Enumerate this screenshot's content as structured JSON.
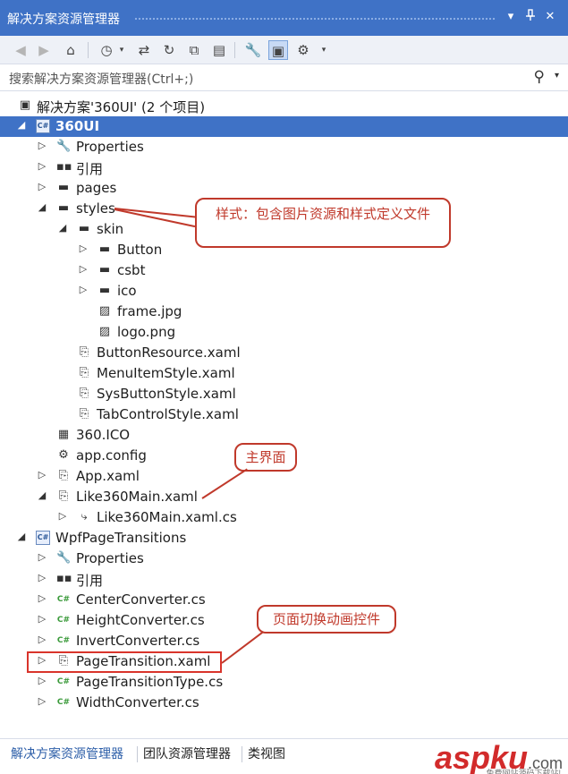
{
  "window": {
    "title": "解决方案资源管理器",
    "pin_symbol": "ᵽ",
    "close_symbol": "✕",
    "dropdown_symbol": "▾"
  },
  "toolbar": {
    "icons": [
      "back-icon",
      "forward-icon",
      "home-icon",
      "pending-changes-icon",
      "sync-icon",
      "refresh-icon",
      "collapse-all-icon",
      "show-all-files-icon",
      "properties-icon",
      "preview-selected-icon",
      "class-diagram-icon"
    ]
  },
  "search": {
    "placeholder": "搜索解决方案资源管理器(Ctrl+;)"
  },
  "tree": {
    "solution": "解决方案'360UI' (2 个项目)",
    "items": [
      {
        "label": "360UI",
        "icon": "csproj-icon",
        "arrow": "expanded"
      },
      {
        "label": "Properties",
        "icon": "wrench-icon",
        "arrow": "collapsed"
      },
      {
        "label": "引用",
        "icon": "references-icon",
        "arrow": "collapsed"
      },
      {
        "label": "pages",
        "icon": "folder-icon",
        "arrow": "collapsed"
      },
      {
        "label": "styles",
        "icon": "folder-icon",
        "arrow": "expanded"
      },
      {
        "label": "skin",
        "icon": "folder-icon",
        "arrow": "expanded"
      },
      {
        "label": "Button",
        "icon": "folder-icon",
        "arrow": "collapsed"
      },
      {
        "label": "csbt",
        "icon": "folder-icon",
        "arrow": "collapsed"
      },
      {
        "label": "ico",
        "icon": "folder-icon",
        "arrow": "collapsed"
      },
      {
        "label": "frame.jpg",
        "icon": "image-icon",
        "arrow": "none"
      },
      {
        "label": "logo.png",
        "icon": "image-icon",
        "arrow": "none"
      },
      {
        "label": "ButtonResource.xaml",
        "icon": "xaml-icon",
        "arrow": "none"
      },
      {
        "label": "MenuItemStyle.xaml",
        "icon": "xaml-icon",
        "arrow": "none"
      },
      {
        "label": "SysButtonStyle.xaml",
        "icon": "xaml-icon",
        "arrow": "none"
      },
      {
        "label": "TabControlStyle.xaml",
        "icon": "xaml-icon",
        "arrow": "none"
      },
      {
        "label": "360.ICO",
        "icon": "ico-file-icon",
        "arrow": "none"
      },
      {
        "label": "app.config",
        "icon": "config-icon",
        "arrow": "none"
      },
      {
        "label": "App.xaml",
        "icon": "xaml-icon",
        "arrow": "collapsed"
      },
      {
        "label": "Like360Main.xaml",
        "icon": "xaml-icon",
        "arrow": "expanded"
      },
      {
        "label": "Like360Main.xaml.cs",
        "icon": "cs-code-icon",
        "arrow": "collapsed"
      },
      {
        "label": "WpfPageTransitions",
        "icon": "csproj-icon",
        "arrow": "expanded"
      },
      {
        "label": "Properties",
        "icon": "wrench-icon",
        "arrow": "collapsed"
      },
      {
        "label": "引用",
        "icon": "references-icon",
        "arrow": "collapsed"
      },
      {
        "label": "CenterConverter.cs",
        "icon": "cs-file-icon",
        "arrow": "collapsed"
      },
      {
        "label": "HeightConverter.cs",
        "icon": "cs-file-icon",
        "arrow": "collapsed"
      },
      {
        "label": "InvertConverter.cs",
        "icon": "cs-file-icon",
        "arrow": "collapsed"
      },
      {
        "label": "PageTransition.xaml",
        "icon": "xaml-icon",
        "arrow": "collapsed"
      },
      {
        "label": "PageTransitionType.cs",
        "icon": "cs-file-icon",
        "arrow": "collapsed"
      },
      {
        "label": "WidthConverter.cs",
        "icon": "cs-file-icon",
        "arrow": "collapsed"
      }
    ]
  },
  "annotations": {
    "styles_note": "样式：包含图片资源和样式定义文件",
    "main_note": "主界面",
    "transition_note": "页面切换动画控件"
  },
  "bottom_tabs": [
    "解决方案资源管理器",
    "团队资源管理器",
    "类视图"
  ],
  "watermark": {
    "brand": "aspku",
    "domain": ".com",
    "subtitle": "免费网站源码下载站!"
  },
  "colors": {
    "accent": "#3f72c6",
    "callout": "#c0392b"
  }
}
